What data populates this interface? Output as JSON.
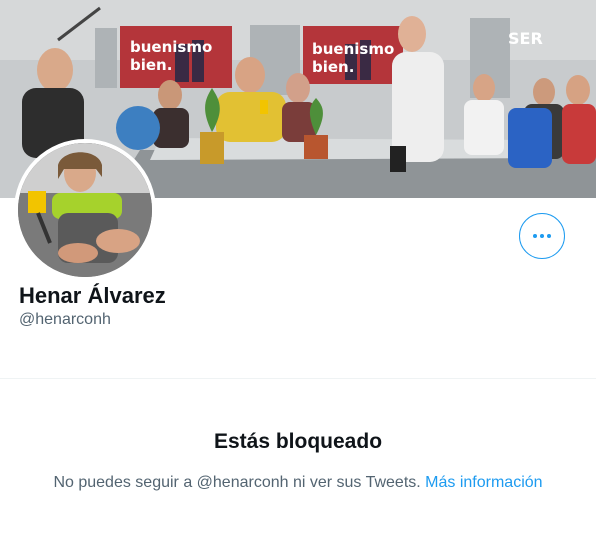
{
  "profile": {
    "display_name": "Henar Álvarez",
    "handle": "@henarconh"
  },
  "banner": {
    "screen_left": [
      "buenismo",
      "bien."
    ],
    "screen_right": [
      "buenismo",
      "bien."
    ],
    "logo": "SER"
  },
  "blocked": {
    "title": "Estás bloqueado",
    "message": "No puedes seguir a @henarconh ni ver sus Tweets.",
    "link": "Más información"
  },
  "colors": {
    "accent": "#1d9bf0",
    "secondary_text": "#536471",
    "primary_text": "#0f1419",
    "screen_bg": "#b4353a"
  },
  "icons": {
    "more": "more-horizontal-icon"
  }
}
